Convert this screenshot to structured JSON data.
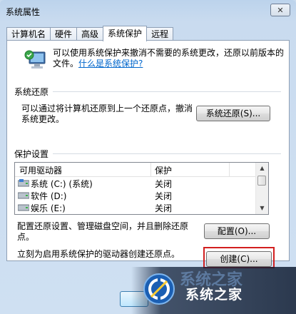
{
  "window": {
    "title": "系统属性",
    "close_glyph": "✕"
  },
  "tabs": [
    {
      "label": "计算机名"
    },
    {
      "label": "硬件"
    },
    {
      "label": "高级"
    },
    {
      "label": "系统保护",
      "active": true
    },
    {
      "label": "远程"
    }
  ],
  "info": {
    "text": "可以使用系统保护来撤消不需要的系统更改，还原以前版本的文件。",
    "link": "什么是系统保护?"
  },
  "restore": {
    "group_label": "系统还原",
    "description": "可以通过将计算机还原到上一个还原点，撤消系统更改。",
    "button": "系统还原(S)..."
  },
  "protection": {
    "group_label": "保护设置",
    "columns": [
      "可用驱动器",
      "保护"
    ],
    "drives": [
      {
        "name": "系统 (C:) (系统)",
        "status": "关闭",
        "icon": "system-drive-icon"
      },
      {
        "name": "软件 (D:)",
        "status": "关闭",
        "icon": "drive-icon"
      },
      {
        "name": "娱乐 (E:)",
        "status": "关闭",
        "icon": "drive-icon"
      }
    ],
    "configure_text": "配置还原设置、管理磁盘空间，并且删除还原点。",
    "configure_button": "配置(O)...",
    "create_text": "立刻为启用系统保护的驱动器创建还原点。",
    "create_button": "创建(C)..."
  },
  "watermark": {
    "text": "系统之家",
    "ghost": "系统之家"
  },
  "colors": {
    "highlight_box": "#d21f1f",
    "link": "#0066cc"
  }
}
